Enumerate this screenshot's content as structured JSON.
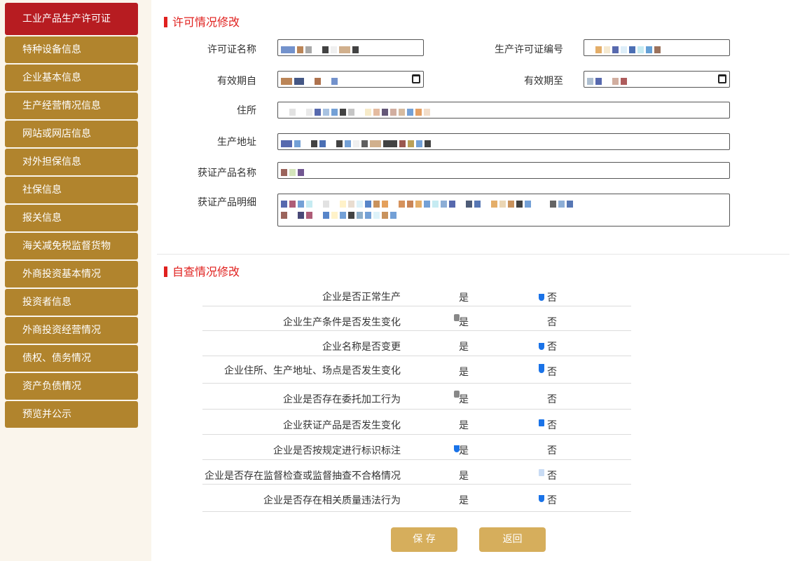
{
  "sidebar": {
    "items": [
      {
        "label": "工业产品生产许可证",
        "active": true
      },
      {
        "label": "特种设备信息"
      },
      {
        "label": "企业基本信息"
      },
      {
        "label": "生产经营情况信息"
      },
      {
        "label": "网站或网店信息"
      },
      {
        "label": "对外担保信息"
      },
      {
        "label": "社保信息"
      },
      {
        "label": "报关信息"
      },
      {
        "label": "海关减免税监督货物"
      },
      {
        "label": "外商投资基本情况"
      },
      {
        "label": "投资者信息"
      },
      {
        "label": "外商投资经营情况"
      },
      {
        "label": "债权、债务情况"
      },
      {
        "label": "资产负债情况"
      },
      {
        "label": "预览并公示"
      }
    ]
  },
  "license_section": {
    "title": "许可情况修改",
    "fields": {
      "license_name": {
        "label": "许可证名称"
      },
      "license_number": {
        "label": "生产许可证编号"
      },
      "valid_from": {
        "label": "有效期自"
      },
      "valid_to": {
        "label": "有效期至"
      },
      "residence": {
        "label": "住所"
      },
      "production_address": {
        "label": "生产地址"
      },
      "product_name": {
        "label": "获证产品名称"
      },
      "product_detail": {
        "label": "获证产品明细"
      }
    }
  },
  "selfcheck_section": {
    "title": "自查情况修改",
    "yes_label": "是",
    "no_label": "否",
    "questions": [
      "企业是否正常生产",
      "企业生产条件是否发生变化",
      "企业名称是否变更",
      "企业住所、生产地址、场点是否发生变化",
      "企业是否存在委托加工行为",
      "企业获证产品是否发生变化",
      "企业是否按规定进行标识标注",
      "企业是否存在监督检查或监督抽查不合格情况",
      "企业是否存在相关质量违法行为"
    ]
  },
  "buttons": {
    "save": "保 存",
    "back": "返回"
  },
  "colors": {
    "sidebar_item": "#b1842d",
    "sidebar_active": "#b71c21",
    "section_title": "#e0201e",
    "button": "#d6ae5c",
    "radio_selected": "#1a73e8"
  }
}
